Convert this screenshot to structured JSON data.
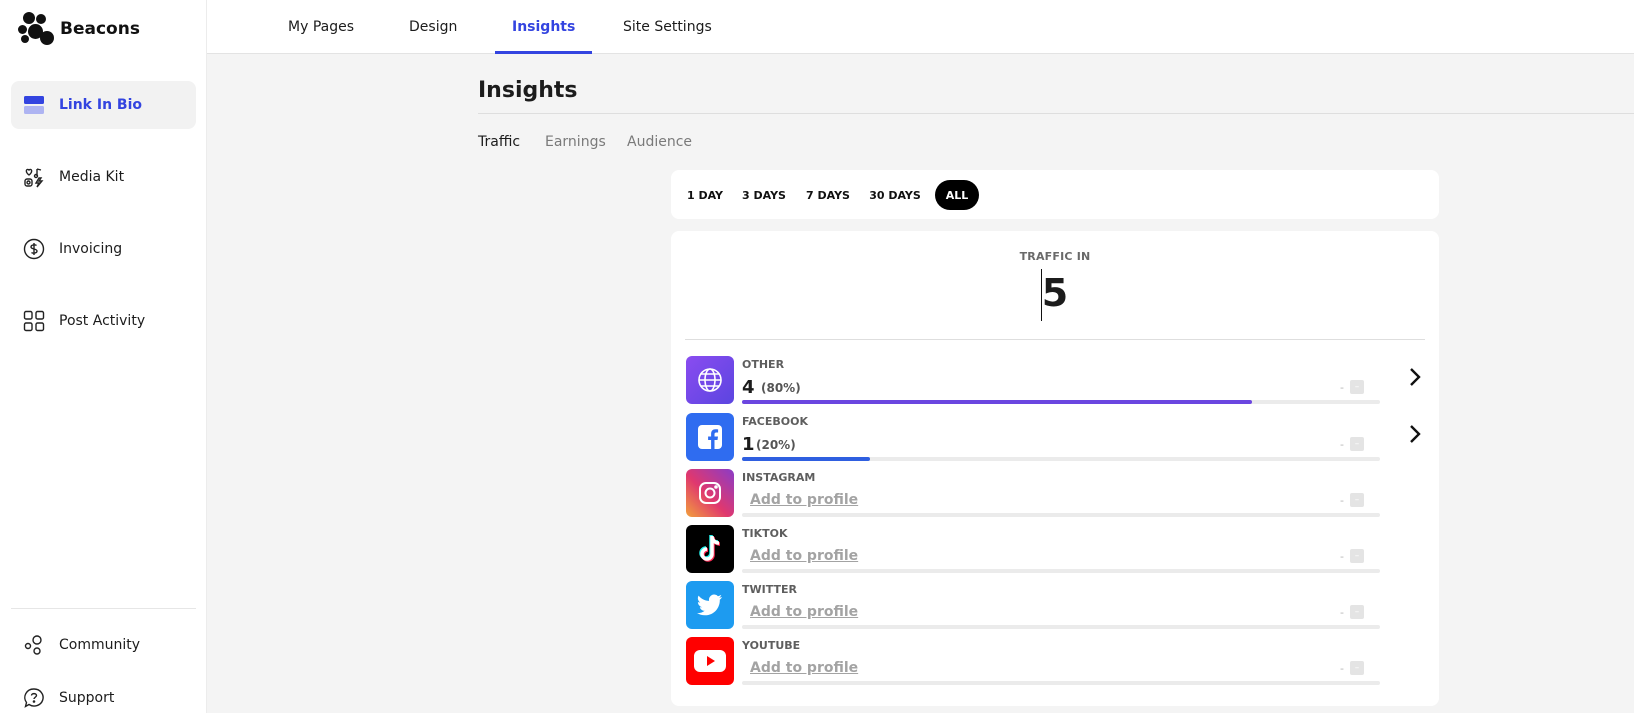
{
  "brand": {
    "name": "Beacons"
  },
  "sidebar": {
    "items": [
      {
        "label": "Link In Bio",
        "icon": "link-in-bio-icon",
        "active": true
      },
      {
        "label": "Media Kit",
        "icon": "media-kit-icon",
        "active": false
      },
      {
        "label": "Invoicing",
        "icon": "dollar-circle-icon",
        "active": false
      },
      {
        "label": "Post Activity",
        "icon": "grid-icon",
        "active": false
      }
    ],
    "bottom": [
      {
        "label": "Community",
        "icon": "community-icon"
      },
      {
        "label": "Support",
        "icon": "support-icon"
      }
    ]
  },
  "topnav": {
    "tabs": [
      {
        "label": "My Pages",
        "active": false
      },
      {
        "label": "Design",
        "active": false
      },
      {
        "label": "Insights",
        "active": true
      },
      {
        "label": "Site Settings",
        "active": false
      }
    ]
  },
  "main": {
    "title": "Insights",
    "subtabs": [
      {
        "label": "Traffic",
        "active": true
      },
      {
        "label": "Earnings",
        "active": false
      },
      {
        "label": "Audience",
        "active": false
      }
    ],
    "ranges": [
      {
        "label": "1 DAY",
        "active": false
      },
      {
        "label": "3 DAYS",
        "active": false
      },
      {
        "label": "7 DAYS",
        "active": false
      },
      {
        "label": "30 DAYS",
        "active": false
      },
      {
        "label": "ALL",
        "active": true
      }
    ],
    "traffic": {
      "label": "TRAFFIC IN",
      "value": "5",
      "sources": [
        {
          "name": "OTHER",
          "count": "4",
          "percent": "(80%)",
          "share": 0.8,
          "color": "#6b46e0",
          "icon": "globe-icon",
          "dash": "-",
          "box": "–"
        },
        {
          "name": "FACEBOOK",
          "count": "1",
          "percent": "(20%)",
          "share": 0.2,
          "color": "#2f5fe0",
          "icon": "facebook-icon",
          "dash": "-",
          "box": "–"
        },
        {
          "name": "INSTAGRAM",
          "add_label": "Add to profile",
          "icon": "instagram-icon",
          "dash": "-",
          "box": "–"
        },
        {
          "name": "TIKTOK",
          "add_label": "Add to profile",
          "icon": "tiktok-icon",
          "dash": "-",
          "box": "–"
        },
        {
          "name": "TWITTER",
          "add_label": "Add to profile",
          "icon": "twitter-icon",
          "dash": "-",
          "box": "–"
        },
        {
          "name": "YOUTUBE",
          "add_label": "Add to profile",
          "icon": "youtube-icon",
          "dash": "-",
          "box": "–"
        }
      ]
    }
  }
}
